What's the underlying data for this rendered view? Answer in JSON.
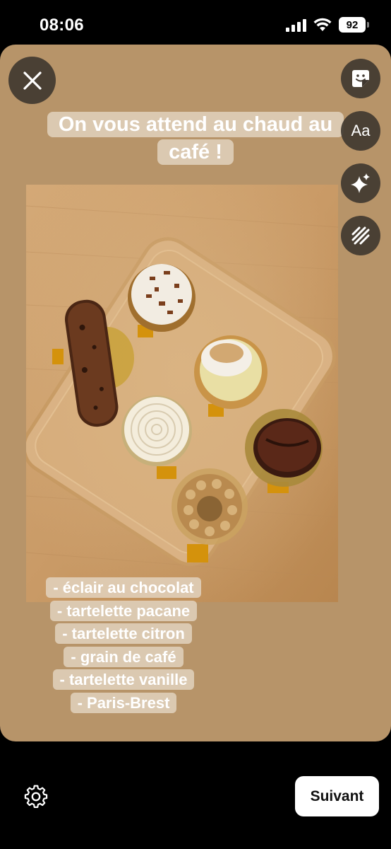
{
  "status_bar": {
    "time": "08:06",
    "battery": "92"
  },
  "editor": {
    "headline_line1": "On vous attend au chaud au",
    "headline_line2": "café !",
    "caption_lines": [
      "- éclair au chocolat",
      "- tartelette pacane",
      "- tartelette citron",
      "- grain de café",
      "- tartelette vanille",
      "- Paris-Brest"
    ]
  },
  "tools": {
    "close": "close-icon",
    "sticker": "sticker-icon",
    "text": "Aa",
    "effects": "sparkle-icon",
    "draw": "draw-icon"
  },
  "bottom_bar": {
    "next_label": "Suivant",
    "settings": "gear-icon"
  },
  "colors": {
    "canvas_background": "#b79469",
    "text_highlight": "#e2d2be",
    "button_background": "#403830"
  }
}
